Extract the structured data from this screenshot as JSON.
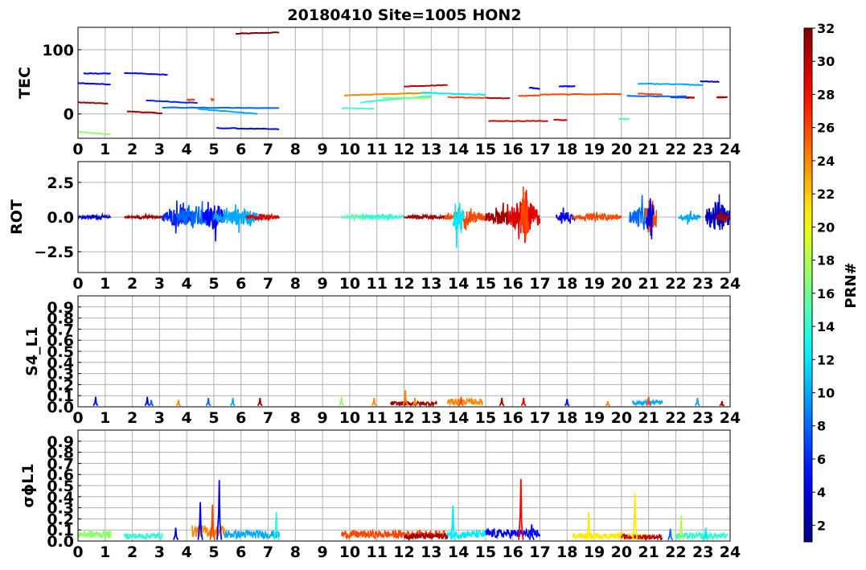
{
  "figure": {
    "title": "20180410 Site=1005 HON2",
    "colorbar_label": "PRN#",
    "colorbar_ticks": [
      "2",
      "4",
      "6",
      "8",
      "10",
      "12",
      "14",
      "16",
      "18",
      "20",
      "22",
      "24",
      "26",
      "28",
      "30",
      "32"
    ],
    "colorbar_range": [
      1,
      32
    ],
    "colormap": "jet"
  },
  "chart_data": [
    {
      "type": "line",
      "ylabel": "TEC",
      "xlim": [
        0,
        24
      ],
      "ylim": [
        -38,
        135
      ],
      "yticks": [
        "0",
        "100"
      ],
      "ytick_values": [
        0,
        100
      ],
      "xticks": [
        "0",
        "1",
        "2",
        "3",
        "4",
        "5",
        "6",
        "7",
        "8",
        "9",
        "10",
        "11",
        "12",
        "13",
        "14",
        "15",
        "16",
        "17",
        "18",
        "19",
        "20",
        "21",
        "22",
        "23",
        "24"
      ],
      "grid": true,
      "series": [
        {
          "prn": 32,
          "x": [
            5.8,
            7.4
          ],
          "y": [
            125,
            127
          ]
        },
        {
          "prn": 5,
          "x": [
            0.2,
            1.2
          ],
          "y": [
            63,
            63
          ]
        },
        {
          "prn": 4,
          "x": [
            0.0,
            1.2
          ],
          "y": [
            48,
            46
          ]
        },
        {
          "prn": 5,
          "x": [
            1.7,
            3.3
          ],
          "y": [
            64,
            61
          ]
        },
        {
          "prn": 31,
          "x": [
            0.0,
            1.1
          ],
          "y": [
            18,
            16
          ]
        },
        {
          "prn": 31,
          "x": [
            1.8,
            3.1
          ],
          "y": [
            4,
            1
          ]
        },
        {
          "prn": 17,
          "x": [
            0.0,
            1.2
          ],
          "y": [
            -28,
            -32
          ]
        },
        {
          "prn": 6,
          "x": [
            2.5,
            4.4
          ],
          "y": [
            21,
            17
          ]
        },
        {
          "prn": 8,
          "x": [
            3.1,
            7.4
          ],
          "y": [
            10,
            9
          ]
        },
        {
          "prn": 10,
          "x": [
            4.4,
            6.6
          ],
          "y": [
            8,
            0
          ]
        },
        {
          "prn": 5,
          "x": [
            5.1,
            7.4
          ],
          "y": [
            -22,
            -24
          ]
        },
        {
          "prn": 26,
          "x": [
            4.0,
            4.3
          ],
          "y": [
            22,
            22
          ]
        },
        {
          "prn": 26,
          "x": [
            4.9,
            5.0
          ],
          "y": [
            23,
            22
          ]
        },
        {
          "prn": 24,
          "x": [
            9.8,
            13.0
          ],
          "y": [
            29,
            33
          ]
        },
        {
          "prn": 15,
          "x": [
            9.7,
            10.9
          ],
          "y": [
            9,
            8
          ]
        },
        {
          "prn": 14,
          "x": [
            10.4,
            13.0
          ],
          "y": [
            18,
            28
          ]
        },
        {
          "prn": 17,
          "x": [
            11.2,
            13.0
          ],
          "y": [
            25,
            25
          ]
        },
        {
          "prn": 30,
          "x": [
            12.0,
            13.6
          ],
          "y": [
            43,
            45
          ]
        },
        {
          "prn": 12,
          "x": [
            12.6,
            15.0
          ],
          "y": [
            33,
            30
          ]
        },
        {
          "prn": 26,
          "x": [
            13.6,
            15.0
          ],
          "y": [
            26,
            25
          ]
        },
        {
          "prn": 30,
          "x": [
            15.0,
            15.9
          ],
          "y": [
            25,
            24
          ]
        },
        {
          "prn": 29,
          "x": [
            15.1,
            17.3
          ],
          "y": [
            -11,
            -11
          ]
        },
        {
          "prn": 29,
          "x": [
            17.5,
            18.0
          ],
          "y": [
            -9,
            -10
          ]
        },
        {
          "prn": 26,
          "x": [
            16.2,
            17.0
          ],
          "y": [
            28,
            29
          ]
        },
        {
          "prn": 5,
          "x": [
            16.6,
            17.0
          ],
          "y": [
            41,
            39
          ]
        },
        {
          "prn": 5,
          "x": [
            17.7,
            18.3
          ],
          "y": [
            43,
            43
          ]
        },
        {
          "prn": 26,
          "x": [
            17.0,
            20.0
          ],
          "y": [
            30,
            31
          ]
        },
        {
          "prn": 8,
          "x": [
            20.2,
            22.4
          ],
          "y": [
            28,
            27
          ]
        },
        {
          "prn": 10,
          "x": [
            20.6,
            22.4
          ],
          "y": [
            47,
            46
          ]
        },
        {
          "prn": 15,
          "x": [
            19.9,
            20.3
          ],
          "y": [
            -8,
            -8
          ]
        },
        {
          "prn": 26,
          "x": [
            20.6,
            21.5
          ],
          "y": [
            32,
            30
          ]
        },
        {
          "prn": 7,
          "x": [
            21.8,
            22.5
          ],
          "y": [
            26,
            25
          ]
        },
        {
          "prn": 30,
          "x": [
            22.4,
            22.7
          ],
          "y": [
            26,
            25
          ]
        },
        {
          "prn": 10,
          "x": [
            22.3,
            23.0
          ],
          "y": [
            46,
            45
          ]
        },
        {
          "prn": 3,
          "x": [
            22.9,
            23.6
          ],
          "y": [
            51,
            50
          ]
        },
        {
          "prn": 31,
          "x": [
            23.5,
            23.9
          ],
          "y": [
            26,
            26
          ]
        }
      ]
    },
    {
      "type": "line",
      "ylabel": "ROT",
      "xlim": [
        0,
        24
      ],
      "ylim": [
        -4,
        4
      ],
      "yticks": [
        "−2.5",
        "0.0",
        "2.5"
      ],
      "ytick_values": [
        -2.5,
        0,
        2.5
      ],
      "xticks": [
        "0",
        "1",
        "2",
        "3",
        "4",
        "5",
        "6",
        "7",
        "8",
        "9",
        "10",
        "11",
        "12",
        "13",
        "14",
        "15",
        "16",
        "17",
        "18",
        "19",
        "20",
        "21",
        "22",
        "23",
        "24"
      ],
      "grid": true,
      "bursts": [
        {
          "prn": 4,
          "x": [
            0.0,
            1.2
          ],
          "amp": 0.3
        },
        {
          "prn": 31,
          "x": [
            1.7,
            3.1
          ],
          "amp": 0.2
        },
        {
          "prn": 6,
          "x": [
            3.1,
            4.3
          ],
          "amp": 1.4
        },
        {
          "prn": 8,
          "x": [
            3.6,
            5.0
          ],
          "amp": 1.6
        },
        {
          "prn": 5,
          "x": [
            4.6,
            5.4
          ],
          "amp": 2.0
        },
        {
          "prn": 10,
          "x": [
            5.0,
            6.8
          ],
          "amp": 1.2
        },
        {
          "prn": 29,
          "x": [
            6.2,
            7.4
          ],
          "amp": 0.4
        },
        {
          "prn": 15,
          "x": [
            9.7,
            11.0
          ],
          "amp": 0.3
        },
        {
          "prn": 14,
          "x": [
            10.5,
            12.0
          ],
          "amp": 0.3
        },
        {
          "prn": 31,
          "x": [
            12.0,
            13.6
          ],
          "amp": 0.3
        },
        {
          "prn": 26,
          "x": [
            13.5,
            15.0
          ],
          "amp": 1.0
        },
        {
          "prn": 12,
          "x": [
            13.8,
            14.2
          ],
          "amp": 3.0
        },
        {
          "prn": 31,
          "x": [
            15.0,
            16.4
          ],
          "amp": 1.2
        },
        {
          "prn": 29,
          "x": [
            15.8,
            17.0
          ],
          "amp": 2.5
        },
        {
          "prn": 26,
          "x": [
            16.3,
            16.6
          ],
          "amp": 3.8
        },
        {
          "prn": 5,
          "x": [
            17.6,
            18.3
          ],
          "amp": 0.8
        },
        {
          "prn": 26,
          "x": [
            18.2,
            20.0
          ],
          "amp": 0.5
        },
        {
          "prn": 8,
          "x": [
            20.3,
            21.2
          ],
          "amp": 1.6
        },
        {
          "prn": 26,
          "x": [
            20.9,
            21.3
          ],
          "amp": 2.8
        },
        {
          "prn": 4,
          "x": [
            20.9,
            21.2
          ],
          "amp": 3.0
        },
        {
          "prn": 10,
          "x": [
            22.1,
            22.9
          ],
          "amp": 0.6
        },
        {
          "prn": 3,
          "x": [
            23.1,
            24.0
          ],
          "amp": 2.3
        },
        {
          "prn": 31,
          "x": [
            23.5,
            24.0
          ],
          "amp": 0.6
        }
      ]
    },
    {
      "type": "line",
      "ylabel": "S4_L1",
      "xlim": [
        0,
        24
      ],
      "ylim": [
        0,
        1
      ],
      "yticks": [
        "0.0",
        "0.1",
        "0.2",
        "0.3",
        "0.4",
        "0.5",
        "0.6",
        "0.7",
        "0.8",
        "0.9"
      ],
      "ytick_values": [
        0,
        0.1,
        0.2,
        0.3,
        0.4,
        0.5,
        0.6,
        0.7,
        0.8,
        0.9
      ],
      "xticks": [
        "0",
        "1",
        "2",
        "3",
        "4",
        "5",
        "6",
        "7",
        "8",
        "9",
        "10",
        "11",
        "12",
        "13",
        "14",
        "15",
        "16",
        "17",
        "18",
        "19",
        "20",
        "21",
        "22",
        "23",
        "24"
      ],
      "grid": true,
      "spikes": [
        {
          "prn": 5,
          "x": 0.65,
          "y": 0.09
        },
        {
          "prn": 4,
          "x": 2.55,
          "y": 0.09
        },
        {
          "prn": 8,
          "x": 2.7,
          "y": 0.06
        },
        {
          "prn": 24,
          "x": 3.7,
          "y": 0.06
        },
        {
          "prn": 8,
          "x": 4.8,
          "y": 0.08
        },
        {
          "prn": 10,
          "x": 5.7,
          "y": 0.08
        },
        {
          "prn": 31,
          "x": 6.7,
          "y": 0.08
        },
        {
          "prn": 17,
          "x": 9.7,
          "y": 0.09
        },
        {
          "prn": 24,
          "x": 10.9,
          "y": 0.08
        },
        {
          "prn": 24,
          "x": 12.05,
          "y": 0.15
        },
        {
          "prn": 24,
          "x": 12.4,
          "y": 0.08
        },
        {
          "prn": 26,
          "x": 14.1,
          "y": 0.09
        },
        {
          "prn": 31,
          "x": 15.6,
          "y": 0.08
        },
        {
          "prn": 29,
          "x": 16.4,
          "y": 0.08
        },
        {
          "prn": 5,
          "x": 18.0,
          "y": 0.07
        },
        {
          "prn": 24,
          "x": 19.5,
          "y": 0.05
        },
        {
          "prn": 26,
          "x": 21.0,
          "y": 0.09
        },
        {
          "prn": 10,
          "x": 22.8,
          "y": 0.08
        },
        {
          "prn": 31,
          "x": 23.7,
          "y": 0.05
        }
      ],
      "bands": [
        {
          "prn": 24,
          "x": [
            13.6,
            14.9
          ],
          "y": 0.06
        },
        {
          "prn": 10,
          "x": [
            20.4,
            21.5
          ],
          "y": 0.05
        },
        {
          "prn": 31,
          "x": [
            11.5,
            13.2
          ],
          "y": 0.04
        }
      ]
    },
    {
      "type": "line",
      "ylabel": "σϕL1",
      "xlim": [
        0,
        24
      ],
      "ylim": [
        0,
        1
      ],
      "yticks": [
        "0.0",
        "0.1",
        "0.2",
        "0.3",
        "0.4",
        "0.5",
        "0.6",
        "0.7",
        "0.8",
        "0.9"
      ],
      "ytick_values": [
        0,
        0.1,
        0.2,
        0.3,
        0.4,
        0.5,
        0.6,
        0.7,
        0.8,
        0.9
      ],
      "xticks": [
        "0",
        "1",
        "2",
        "3",
        "4",
        "5",
        "6",
        "7",
        "8",
        "9",
        "10",
        "11",
        "12",
        "13",
        "14",
        "15",
        "16",
        "17",
        "18",
        "19",
        "20",
        "21",
        "22",
        "23",
        "24"
      ],
      "grid": true,
      "spikes": [
        {
          "prn": 4,
          "x": 3.6,
          "y": 0.12
        },
        {
          "prn": 5,
          "x": 4.5,
          "y": 0.35
        },
        {
          "prn": 26,
          "x": 4.95,
          "y": 0.33
        },
        {
          "prn": 5,
          "x": 5.2,
          "y": 0.55
        },
        {
          "prn": 14,
          "x": 7.3,
          "y": 0.26
        },
        {
          "prn": 12,
          "x": 13.8,
          "y": 0.32
        },
        {
          "prn": 28,
          "x": 16.3,
          "y": 0.56
        },
        {
          "prn": 5,
          "x": 16.7,
          "y": 0.15
        },
        {
          "prn": 21,
          "x": 18.8,
          "y": 0.26
        },
        {
          "prn": 21,
          "x": 20.5,
          "y": 0.43
        },
        {
          "prn": 18,
          "x": 22.2,
          "y": 0.23
        },
        {
          "prn": 8,
          "x": 21.8,
          "y": 0.11
        },
        {
          "prn": 12,
          "x": 23.1,
          "y": 0.12
        }
      ],
      "bands": [
        {
          "prn": 17,
          "x": [
            0.0,
            1.2
          ],
          "y": 0.08
        },
        {
          "prn": 14,
          "x": [
            1.7,
            3.1
          ],
          "y": 0.06
        },
        {
          "prn": 24,
          "x": [
            4.2,
            5.4
          ],
          "y": 0.12
        },
        {
          "prn": 10,
          "x": [
            5.4,
            7.4
          ],
          "y": 0.08
        },
        {
          "prn": 26,
          "x": [
            9.7,
            13.5
          ],
          "y": 0.08
        },
        {
          "prn": 31,
          "x": [
            12.0,
            13.6
          ],
          "y": 0.06
        },
        {
          "prn": 12,
          "x": [
            13.6,
            15.0
          ],
          "y": 0.08
        },
        {
          "prn": 5,
          "x": [
            15.0,
            17.0
          ],
          "y": 0.09
        },
        {
          "prn": 21,
          "x": [
            18.2,
            20.9
          ],
          "y": 0.06
        },
        {
          "prn": 30,
          "x": [
            20.0,
            21.5
          ],
          "y": 0.05
        },
        {
          "prn": 14,
          "x": [
            22.0,
            23.9
          ],
          "y": 0.06
        }
      ]
    }
  ]
}
